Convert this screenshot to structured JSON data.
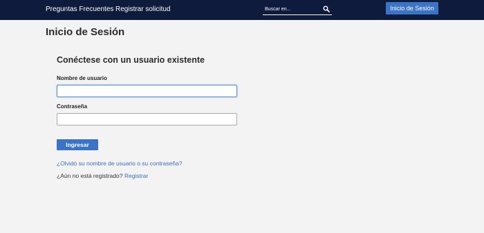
{
  "nav": {
    "faq": "Preguntas Frecuentes",
    "register_request": "Registrar solicitud",
    "search_placeholder": "Buscar en...",
    "search_icon": "search-icon",
    "login_button": "Inicio de Sesión"
  },
  "page": {
    "title": "Inicio de Sesión",
    "subtitle": "Conéctese con un usuario existente"
  },
  "form": {
    "username_label": "Nombre de usuario",
    "username_value": "",
    "password_label": "Contraseña",
    "password_value": "",
    "submit_label": "Ingresar",
    "forgot_link": "¿Olvidó su nombre de usuario o su contraseña?",
    "not_registered_text": "¿Aún no está registrado?",
    "register_link": "Registrar"
  },
  "colors": {
    "topbar": "#0e1b3d",
    "accent": "#3b73c6",
    "link": "#3b6fb6",
    "background": "#f3f3f3"
  }
}
